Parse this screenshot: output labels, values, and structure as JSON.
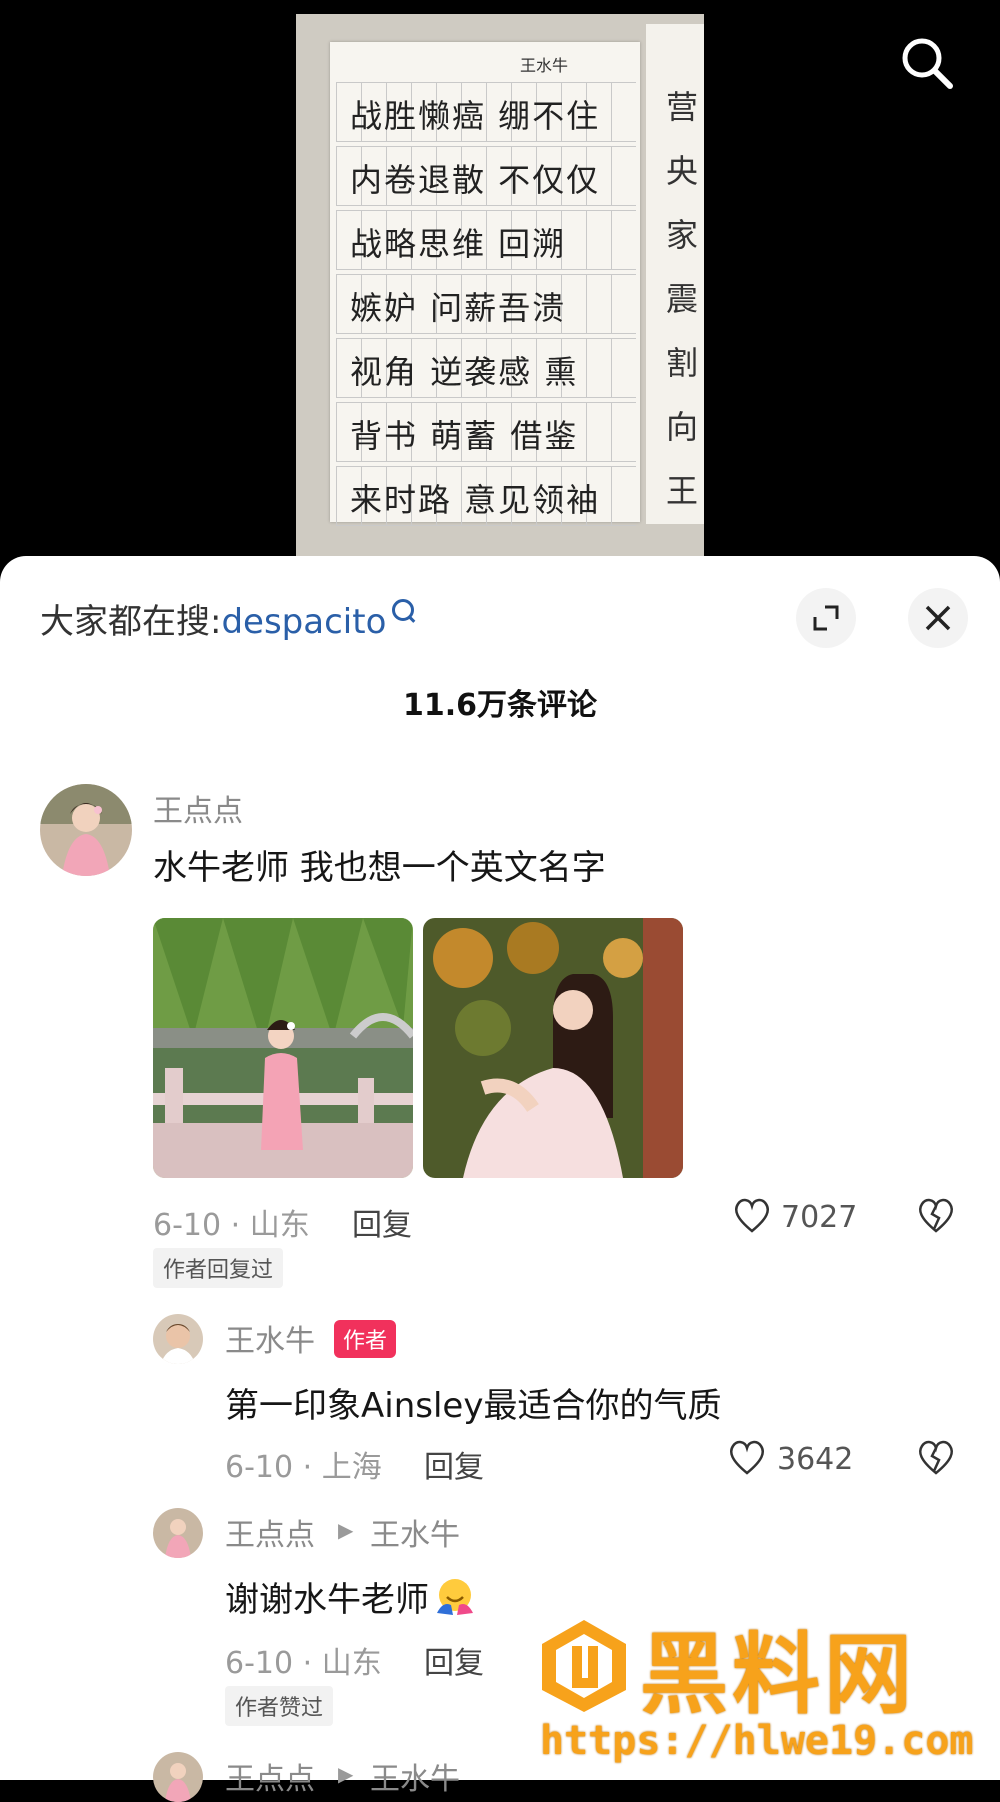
{
  "video": {
    "notebook_name": "王水牛",
    "rows": [
      "战胜懒癌  绷不住",
      "内卷退散  不仅仅",
      "战略思维  回溯",
      "嫉妒 问薪吾溃",
      "视角 逆袭感  熏",
      "背书 萌蓄  借鉴",
      "来时路  意见领袖"
    ],
    "side_chars": [
      "营",
      "央",
      "家",
      "震",
      "割",
      "向",
      "王"
    ]
  },
  "sheet": {
    "trend_prefix": "大家都在搜:",
    "trend_term": "despacito",
    "comment_count": "11.6万条评论"
  },
  "comments": {
    "c1": {
      "name": "王点点",
      "text": "水牛老师 我也想一个英文名字",
      "date_loc": "6-10 · 山东",
      "reply": "回复",
      "likes": "7027",
      "tag": "作者回复过"
    },
    "r1": {
      "name": "王水牛",
      "badge": "作者",
      "text": "第一印象Ainsley最适合你的气质",
      "date_loc": "6-10 · 上海",
      "reply": "回复",
      "likes": "3642"
    },
    "r2": {
      "name": "王点点",
      "arrow": "▶",
      "reply_to": "王水牛",
      "text": "谢谢水牛老师",
      "date_loc": "6-10 · 山东",
      "reply": "回复",
      "tag": "作者赞过"
    },
    "r3": {
      "name": "王点点",
      "arrow": "▶",
      "reply_to": "王水牛"
    }
  },
  "watermark": {
    "title": "黑料网",
    "url": "https://hlwe19.com"
  },
  "colors": {
    "trend_blue": "#2a5fa8",
    "author_badge": "#f1315c",
    "watermark_orange": "#f7a21b"
  }
}
